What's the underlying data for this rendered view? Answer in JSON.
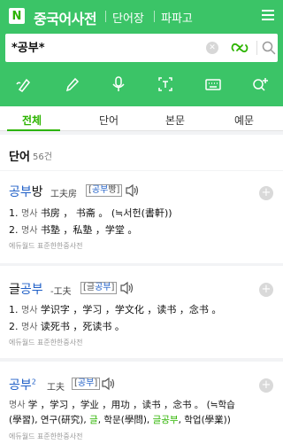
{
  "header": {
    "logo": "N",
    "title": "중국어사전",
    "links": [
      "단어장",
      "파파고"
    ]
  },
  "search": {
    "query": "*공부*"
  },
  "tools": [
    "handwriting-icon",
    "pen-icon",
    "microphone-icon",
    "text-recognition-icon",
    "keyboard-icon",
    "search-plus-icon"
  ],
  "tabs": [
    "전체",
    "단어",
    "본문",
    "예문"
  ],
  "section": {
    "title": "단어",
    "count": "56건"
  },
  "entries": [
    {
      "headword_hl": "공부",
      "headword_rest": "방",
      "hanja": "工夫房",
      "pron_hl": "공부",
      "pron_rest": "빵",
      "defs": [
        {
          "num": "1.",
          "pos": "명사",
          "text": "书房 ， 书斋 。 (≒서헌(書軒))"
        },
        {
          "num": "2.",
          "pos": "명사",
          "text": "书塾 ，私塾 ，学堂 。"
        }
      ],
      "source": "에듀월드 표준한한중사전"
    },
    {
      "headword_pre": "글",
      "headword_hl": "공부",
      "hanja": "-工夫",
      "pron_pre": "글",
      "pron_hl": "공부",
      "defs": [
        {
          "num": "1.",
          "pos": "명사",
          "text": "学识字 ，学习 ，学文化 ，读书 ，念书 。"
        },
        {
          "num": "2.",
          "pos": "명사",
          "text": "读死书 ，死读书 。"
        }
      ],
      "source": "에듀월드 표준한한중사전"
    },
    {
      "headword_hl": "공부",
      "sup": "2",
      "hanja": "工夫",
      "pron_hl": "공부",
      "def_line1_pos": "명사",
      "def_line1_text": "学 ，学习 ，学业 ，用功 ，读书 ，念书 。 (≒학습",
      "def_line2_pre": "(學習), 연구(研究), ",
      "def_line2_g1": "글",
      "def_line2_mid": ", 학문(學問), ",
      "def_line2_g2": "글공부",
      "def_line2_post": ", 학업(學業))",
      "source": "에듀월드 표준한한중사전"
    }
  ]
}
